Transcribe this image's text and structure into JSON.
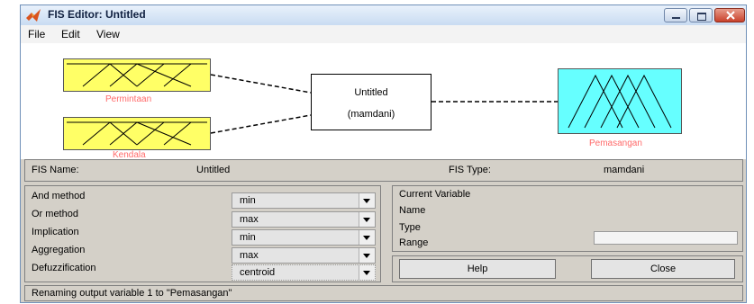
{
  "window": {
    "title": "FIS Editor: Untitled"
  },
  "menu": [
    "File",
    "Edit",
    "View"
  ],
  "diagram": {
    "inputs": [
      "Permintaan",
      "Kendala"
    ],
    "output": "Pemasangan",
    "system_name": "Untitled",
    "system_type": "(mamdani)"
  },
  "info": {
    "fis_name_label": "FIS Name:",
    "fis_name_value": "Untitled",
    "fis_type_label": "FIS Type:",
    "fis_type_value": "mamdani"
  },
  "methods": [
    {
      "label": "And method",
      "value": "min"
    },
    {
      "label": "Or method",
      "value": "max"
    },
    {
      "label": "Implication",
      "value": "min"
    },
    {
      "label": "Aggregation",
      "value": "max"
    },
    {
      "label": "Defuzzification",
      "value": "centroid"
    }
  ],
  "current_variable": {
    "title": "Current Variable",
    "name_label": "Name",
    "type_label": "Type",
    "range_label": "Range",
    "name_value": ""
  },
  "buttons": {
    "help": "Help",
    "close": "Close"
  },
  "status": "Renaming output variable 1 to \"Pemasangan\"",
  "colors": {
    "input_mf_bg": "#ffff66",
    "output_mf_bg": "#66ffff",
    "label": "#ff6a6a"
  }
}
